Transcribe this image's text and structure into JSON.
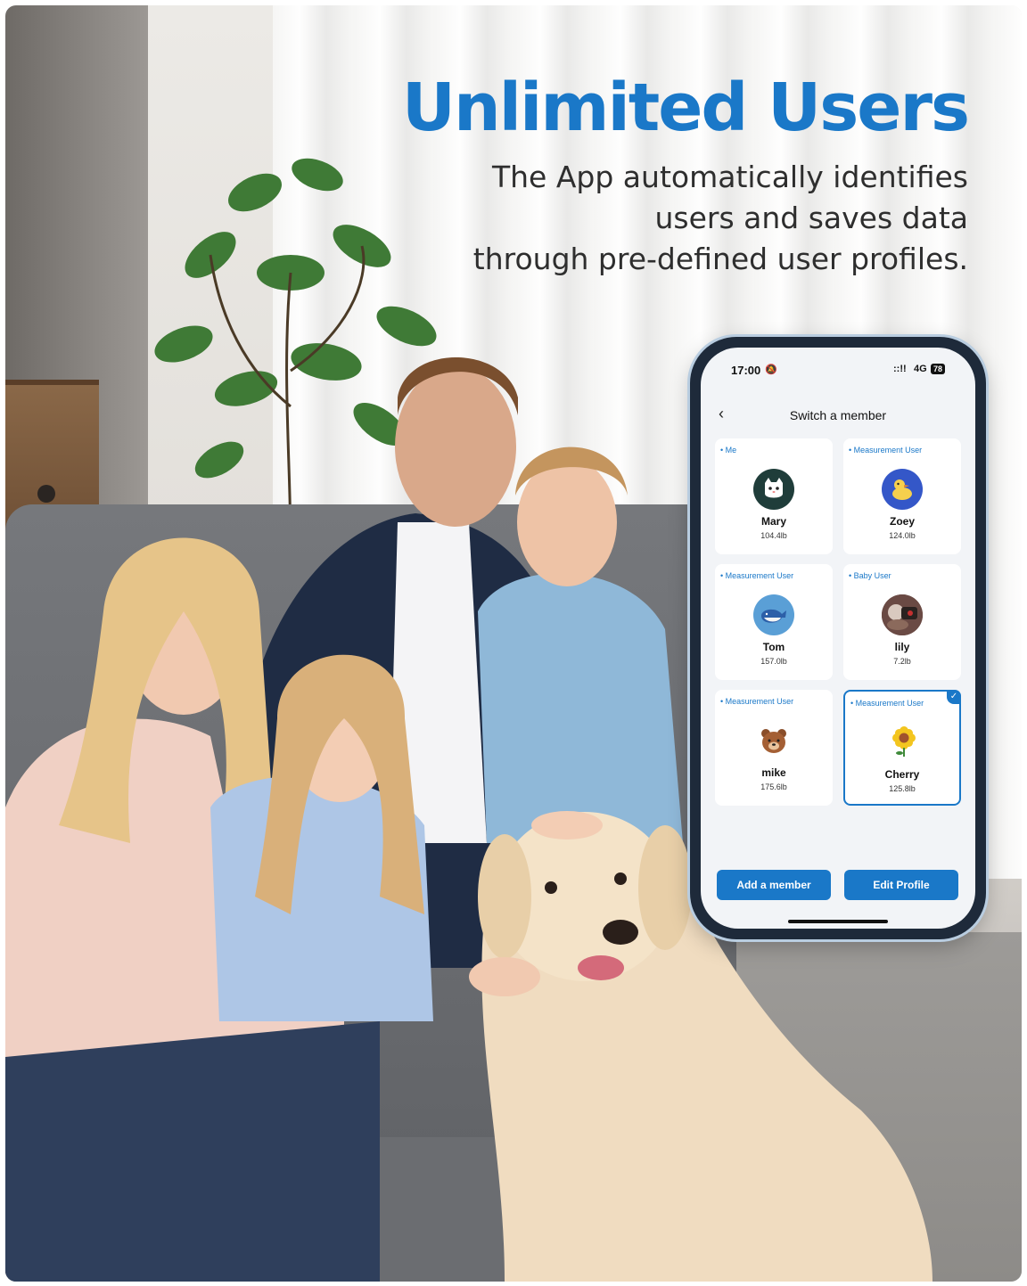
{
  "headline": "Unlimited Users",
  "subtitle_lines": [
    "The App automatically identifies",
    "users and saves data",
    "through pre-defined user profiles."
  ],
  "phone": {
    "status": {
      "time": "17:00",
      "bell_icon": "bell-slash-icon",
      "signal": "::!!",
      "network": "4G",
      "battery": "78"
    },
    "nav": {
      "back_icon": "chevron-left-icon",
      "title": "Switch a member"
    },
    "members": [
      {
        "type": "Me",
        "name": "Mary",
        "weight": "104.4lb",
        "avatar_icon": "cat-icon",
        "avatar_color": "#1f3d3a",
        "selected": false
      },
      {
        "type": "Measurement User",
        "name": "Zoey",
        "weight": "124.0lb",
        "avatar_icon": "duck-icon",
        "avatar_color": "#3457c8",
        "selected": false
      },
      {
        "type": "Measurement User",
        "name": "Tom",
        "weight": "157.0lb",
        "avatar_icon": "whale-icon",
        "avatar_color": "#5a9fd6",
        "selected": false
      },
      {
        "type": "Baby User",
        "name": "lily",
        "weight": "7.2lb",
        "avatar_icon": "photo-avatar",
        "avatar_color": "#6a4a44",
        "selected": false
      },
      {
        "type": "Measurement User",
        "name": "mike",
        "weight": "175.6lb",
        "avatar_icon": "bear-icon",
        "avatar_color": "#ffffff",
        "selected": false
      },
      {
        "type": "Measurement User",
        "name": "Cherry",
        "weight": "125.8lb",
        "avatar_icon": "sunflower-icon",
        "avatar_color": "#ffffff",
        "selected": true
      }
    ],
    "buttons": {
      "add": "Add a member",
      "edit": "Edit Profile"
    }
  },
  "colors": {
    "accent": "#1a78c8"
  }
}
